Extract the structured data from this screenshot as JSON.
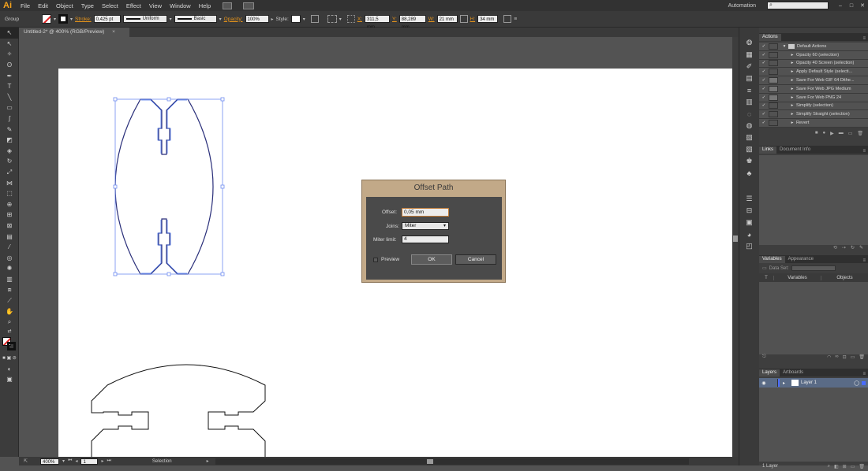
{
  "app": {
    "logo": "Ai",
    "workspace": "Automation",
    "search_placeholder": ""
  },
  "menu": [
    "File",
    "Edit",
    "Object",
    "Type",
    "Select",
    "Effect",
    "View",
    "Window",
    "Help"
  ],
  "control_bar": {
    "selection_type": "Group",
    "stroke_label": "Stroke:",
    "stroke_value": "0,425 pt",
    "profile": "Uniform",
    "brush": "Basic",
    "opacity_label": "Opacity:",
    "opacity_value": "100%",
    "style_label": "Style:",
    "x_label": "X:",
    "x_value": "311,5 mm",
    "y_label": "Y:",
    "y_value": "88,289 mm",
    "w_label": "W:",
    "w_value": "21 mm",
    "h_label": "H:",
    "h_value": "34 mm"
  },
  "document_tab": "Untitled-2* @ 400% (RGB/Preview)",
  "status_bar": {
    "zoom": "400%",
    "page": "1",
    "tool": "Selection"
  },
  "dialog": {
    "title": "Offset Path",
    "offset_label": "Offset:",
    "offset_value": "0,05 mm",
    "joins_label": "Joins:",
    "joins_value": "Miter",
    "miter_label": "Miter limit:",
    "miter_value": "4",
    "preview_label": "Preview",
    "ok_label": "OK",
    "cancel_label": "Cancel"
  },
  "actions_panel": {
    "tab": "Actions",
    "items": [
      {
        "label": "Default Actions",
        "folder": true
      },
      {
        "label": "Opacity 60 (selection)"
      },
      {
        "label": "Opacity 40 Screen (selection)"
      },
      {
        "label": "Apply Default Style (selecti..."
      },
      {
        "label": "Save For Web GIF 64 Dithe..."
      },
      {
        "label": "Save For Web JPG Medium"
      },
      {
        "label": "Save For Web PNG 24"
      },
      {
        "label": "Simplify (selection)"
      },
      {
        "label": "Simplify Straight (selection)"
      },
      {
        "label": "Revert"
      }
    ]
  },
  "links_panel": {
    "tabs": [
      "Links",
      "Document Info"
    ]
  },
  "variables_panel": {
    "tabs": [
      "Variables",
      "Appearance"
    ],
    "data_set_label": "Data Set:",
    "col_variables": "Variables",
    "col_objects": "Objects"
  },
  "layers_panel": {
    "tabs": [
      "Layers",
      "Artboards"
    ],
    "layer_name": "Layer 1",
    "footer_count": "1 Layer"
  }
}
